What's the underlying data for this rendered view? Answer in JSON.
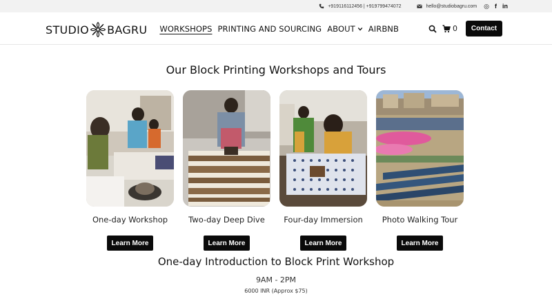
{
  "topbar": {
    "phones": "+919116112456 | +919799474072",
    "email": "hello@studiobagru.com",
    "social": [
      {
        "name": "instagram-icon",
        "glyph": "◎"
      },
      {
        "name": "facebook-icon",
        "glyph": "f"
      },
      {
        "name": "linkedin-icon",
        "glyph": "in"
      }
    ]
  },
  "header": {
    "logo_left": "STUDIO",
    "logo_right": "BAGRU",
    "nav": [
      {
        "label": "WORKSHOPS",
        "active": true
      },
      {
        "label": "PRINTING AND SOURCING",
        "active": false
      },
      {
        "label": "ABOUT",
        "active": false,
        "dropdown": true
      },
      {
        "label": "AIRBNB",
        "active": false
      }
    ],
    "cart_count": "0",
    "contact_label": "Contact"
  },
  "main": {
    "heading": "Our Block Printing Workshops and Tours",
    "cards": [
      {
        "title": "One-day Workshop",
        "button": "Learn More",
        "photo": "workshop-photo"
      },
      {
        "title": "Two-day Deep Dive",
        "button": "Learn More",
        "photo": "deep-dive-photo"
      },
      {
        "title": "Four-day Immersion",
        "button": "Learn More",
        "photo": "immersion-photo"
      },
      {
        "title": "Photo Walking Tour",
        "button": "Learn More",
        "photo": "walking-tour-photo"
      }
    ],
    "sub_heading": "One-day Introduction to Block Print Workshop",
    "time": "9AM - 2PM",
    "price": "6000 INR (Approx $75)"
  },
  "colors": {
    "topbar_bg": "#f2f2f2",
    "button_bg": "#0a0a0a",
    "button_text": "#ffffff"
  }
}
